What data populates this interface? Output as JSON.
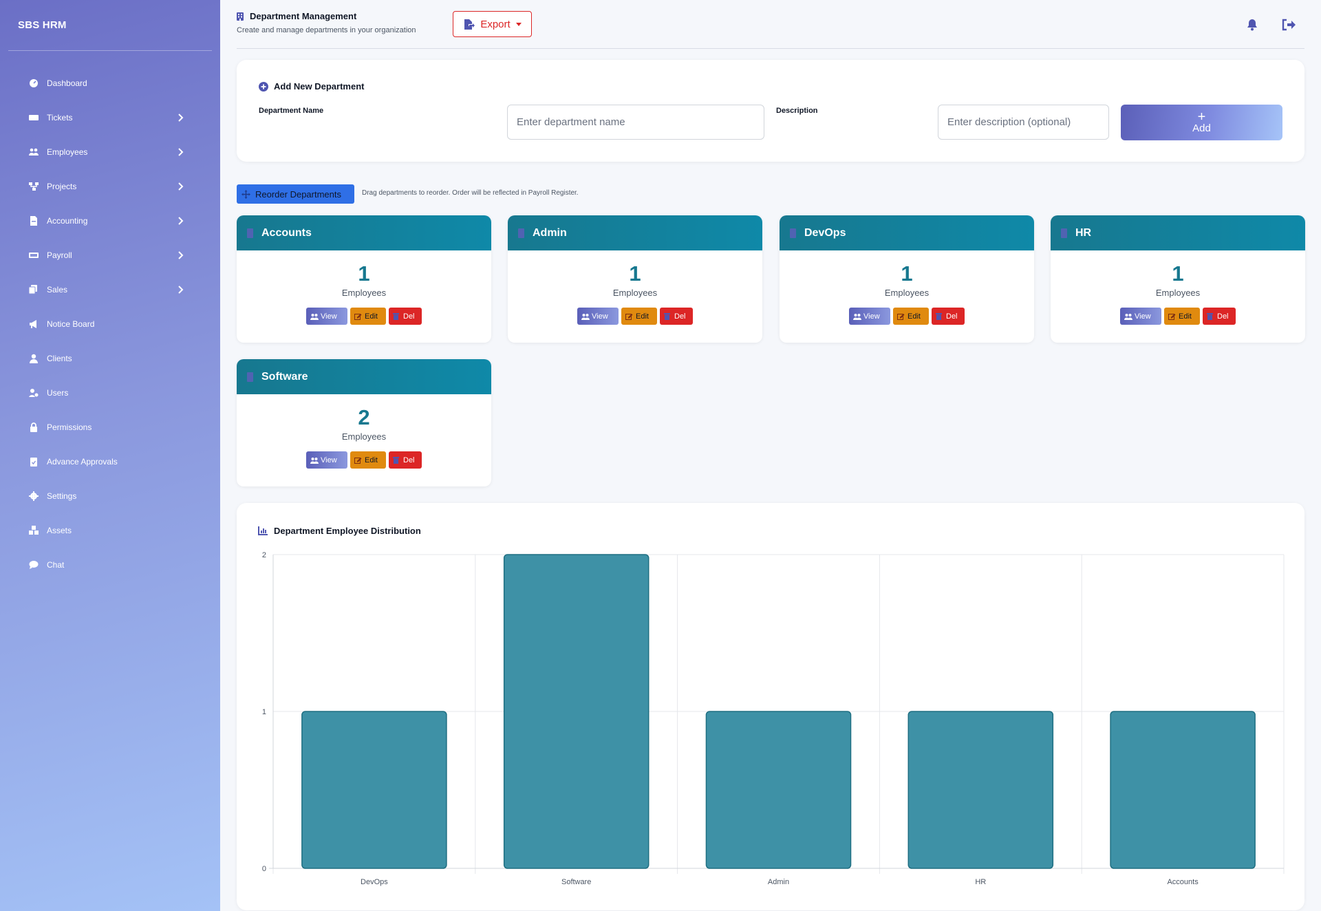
{
  "app": {
    "brand": "SBS HRM"
  },
  "sidebar": {
    "items": [
      {
        "label": "Dashboard",
        "icon": "dashboard-icon",
        "chevron": false
      },
      {
        "label": "Tickets",
        "icon": "ticket-icon",
        "chevron": true
      },
      {
        "label": "Employees",
        "icon": "users-icon",
        "chevron": true
      },
      {
        "label": "Projects",
        "icon": "sitemap-icon",
        "chevron": true
      },
      {
        "label": "Accounting",
        "icon": "file-invoice-icon",
        "chevron": true
      },
      {
        "label": "Payroll",
        "icon": "money-bill-icon",
        "chevron": true
      },
      {
        "label": "Sales",
        "icon": "copy-icon",
        "chevron": true
      },
      {
        "label": "Notice Board",
        "icon": "megaphone-icon",
        "chevron": false
      },
      {
        "label": "Clients",
        "icon": "user-icon",
        "chevron": false
      },
      {
        "label": "Users",
        "icon": "user-cog-icon",
        "chevron": false
      },
      {
        "label": "Permissions",
        "icon": "lock-icon",
        "chevron": false
      },
      {
        "label": "Advance Approvals",
        "icon": "clipboard-check-icon",
        "chevron": false
      },
      {
        "label": "Settings",
        "icon": "gear-icon",
        "chevron": false
      },
      {
        "label": "Assets",
        "icon": "boxes-icon",
        "chevron": false
      },
      {
        "label": "Chat",
        "icon": "chat-icon",
        "chevron": false
      }
    ]
  },
  "header": {
    "title": "Department Management",
    "subtitle": "Create and manage departments in your organization",
    "export_label": "Export"
  },
  "add_form": {
    "title": "Add New Department",
    "name_label": "Department Name",
    "name_placeholder": "Enter department name",
    "name_value": "",
    "desc_label": "Description",
    "desc_placeholder": "Enter description (optional)",
    "desc_value": "",
    "add_label": "Add"
  },
  "reorder": {
    "button_label": "Reorder Departments",
    "hint": "Drag departments to reorder. Order will be reflected in Payroll Register."
  },
  "departments": [
    {
      "name": "Accounts",
      "count": "1",
      "unit": "Employees"
    },
    {
      "name": "Admin",
      "count": "1",
      "unit": "Employees"
    },
    {
      "name": "DevOps",
      "count": "1",
      "unit": "Employees"
    },
    {
      "name": "HR",
      "count": "1",
      "unit": "Employees"
    },
    {
      "name": "Software",
      "count": "2",
      "unit": "Employees"
    }
  ],
  "actions": {
    "view": "View",
    "edit": "Edit",
    "del": "Del"
  },
  "colors": {
    "accent": "#5b5fb8",
    "teal": "#17788f",
    "bar_fill": "#3e91a6",
    "bar_stroke": "#1f6f82",
    "danger": "#dc2626",
    "warning": "#e08a0f",
    "reorder": "#2f6fe6"
  },
  "chart_data": {
    "type": "bar",
    "title": "Department Employee Distribution",
    "categories": [
      "DevOps",
      "Software",
      "Admin",
      "HR",
      "Accounts"
    ],
    "values": [
      1,
      2,
      1,
      1,
      1
    ],
    "ylim": [
      0,
      2
    ],
    "yticks": [
      "0",
      "1",
      "2"
    ],
    "grid": true,
    "legend": "none"
  }
}
